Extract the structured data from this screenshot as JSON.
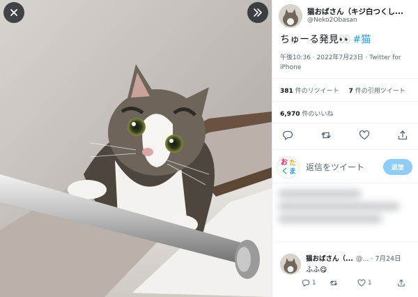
{
  "media": {
    "close_icon": "close-icon",
    "expand_icon": "double-chevron-right-icon",
    "photo_alt": "cat-photo"
  },
  "tweet": {
    "author_name": "猫おばさん（キジ白つくし...",
    "author_handle": "@Neko2Obasan",
    "text": "ちゅーる発見",
    "text_emoji": "👀",
    "hashtag": "#猫",
    "meta": "午後10:36 · 2022年7月23日 · Twitter for iPhone",
    "retweets_count": "381",
    "retweets_label": " 件のリツイート",
    "quotes_count": "7",
    "quotes_label": " 件の引用ツイート",
    "likes_count": "6,970",
    "likes_label": " 件のいいね"
  },
  "actions": {
    "icons": [
      "reply-icon",
      "retweet-icon",
      "like-icon",
      "share-icon"
    ]
  },
  "compose": {
    "avatar_chars": [
      "お",
      "た",
      "く",
      "ま"
    ],
    "placeholder": "返信をツイート",
    "button_label": "返信"
  },
  "reply": {
    "name": "猫おばさん（...",
    "handle_date": "@... · 7月24日",
    "text": "ふふ",
    "emoji": "😋",
    "reply_count": "1",
    "like_count": "1"
  },
  "colors": {
    "accent": "#1d9bf0",
    "reply_button": "#8ecdf8",
    "secondary_text": "#536471",
    "avatar_chars": [
      "#e0245e",
      "#f5a623",
      "#17bf63",
      "#1d9bf0"
    ]
  }
}
